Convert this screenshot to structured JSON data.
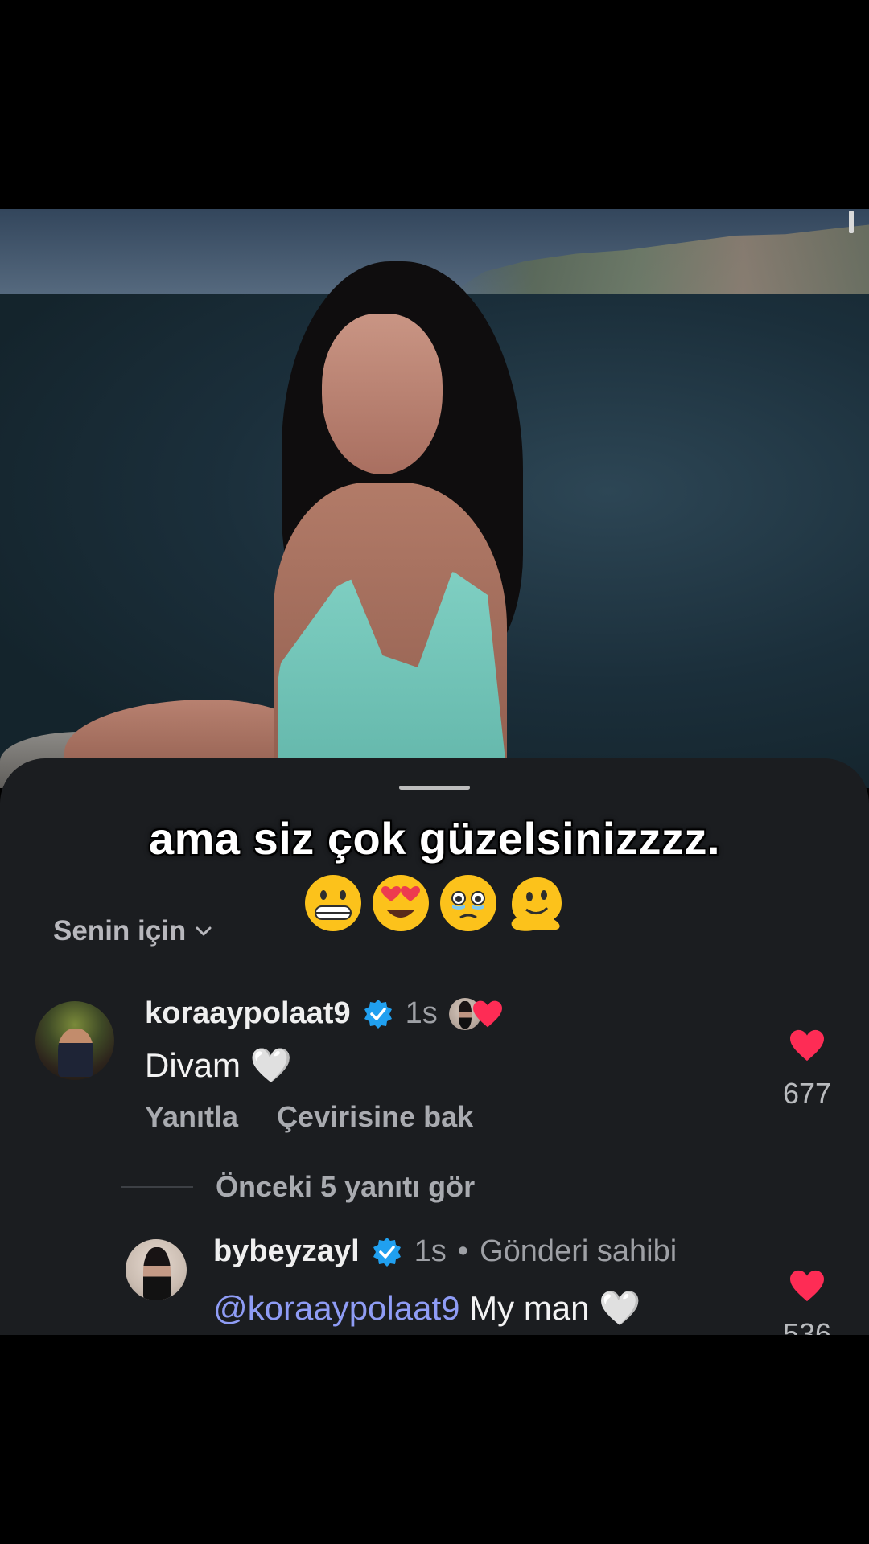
{
  "caption": {
    "text": "ama siz çok güzelsinizzzz.",
    "emojis": [
      "grinning-face",
      "heart-eyes-face",
      "holding-back-tears-face",
      "melting-face"
    ]
  },
  "comments_sheet": {
    "filter_label": "Senin için",
    "comments": [
      {
        "username": "koraaypolaat9",
        "verified": true,
        "time": "1s",
        "liked_by_creator": true,
        "text": "Divam 🤍",
        "actions": {
          "reply": "Yanıtla",
          "translate": "Çevirisine bak"
        },
        "likes": "677"
      }
    ],
    "previous_replies_label": "Önceki 5 yanıtı gör",
    "replies": [
      {
        "username": "bybeyzayl",
        "verified": true,
        "time": "1s",
        "separator": "•",
        "owner_label": "Gönderi sahibi",
        "mention": "@koraaypolaat9",
        "text": " My man 🤍",
        "likes": "536"
      }
    ]
  },
  "colors": {
    "sheet_bg": "#1b1d20",
    "like_red": "#fe2c55",
    "verified_blue": "#20a0f0",
    "mention": "#8f9cf5"
  }
}
